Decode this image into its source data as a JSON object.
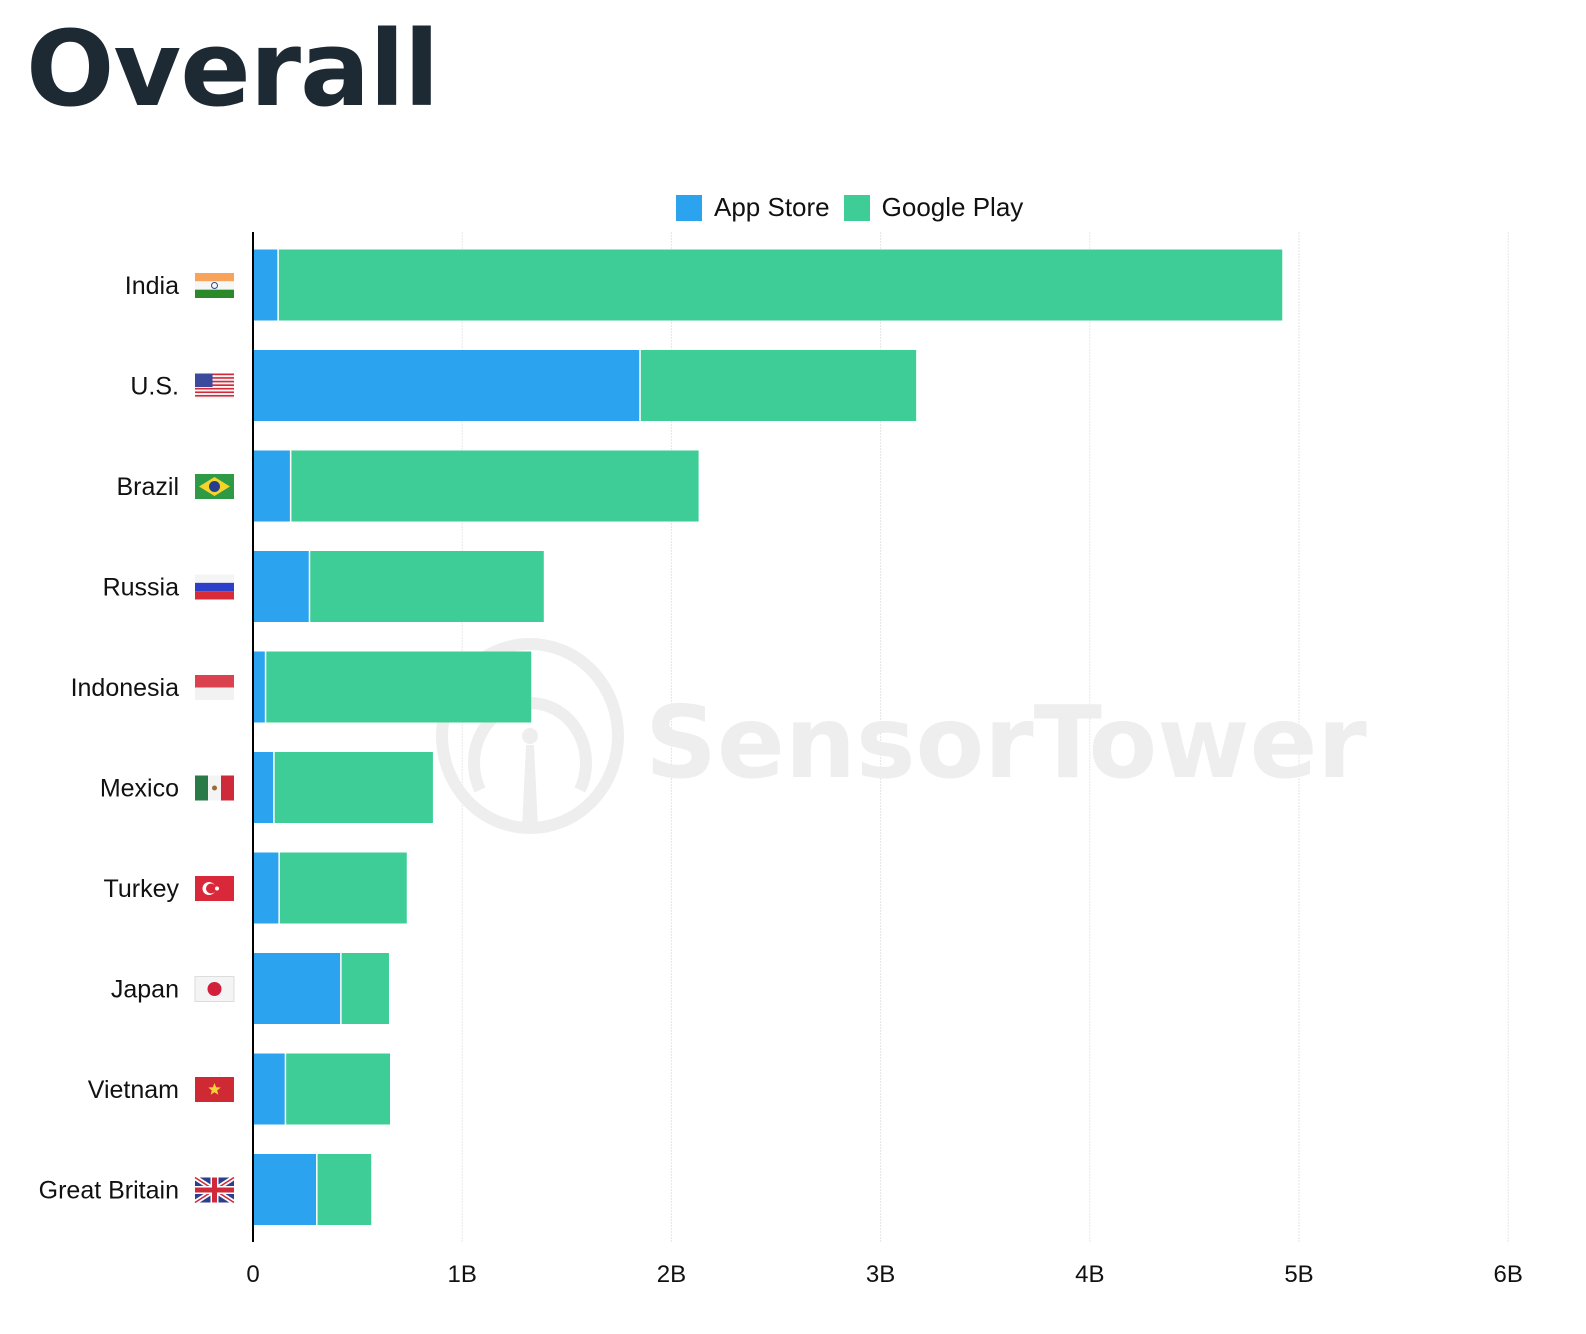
{
  "page": {
    "title": "Overall",
    "watermark": "SensorTower"
  },
  "colors": {
    "app_store": "#2ba3ee",
    "google_play": "#3ecd96",
    "title": "#1e2a33",
    "grid": "#e6e6e6",
    "axis": "#000000",
    "watermark": "#eeeeee"
  },
  "chart_data": {
    "type": "bar",
    "orientation": "horizontal",
    "stacked": true,
    "title": "Overall",
    "xlabel": "",
    "ylabel": "",
    "xlim": [
      0,
      6000000000
    ],
    "x_ticks": [
      "0",
      "1B",
      "2B",
      "3B",
      "4B",
      "5B",
      "6B"
    ],
    "x_tick_values": [
      0,
      1,
      2,
      3,
      4,
      5,
      6
    ],
    "unit": "billions",
    "grid": "vertical",
    "legend_position": "top-center",
    "categories": [
      "India",
      "U.S.",
      "Brazil",
      "Russia",
      "Indonesia",
      "Mexico",
      "Turkey",
      "Japan",
      "Vietnam",
      "Great Britain"
    ],
    "flags": [
      "flag-india",
      "flag-us",
      "flag-brazil",
      "flag-russia",
      "flag-indonesia",
      "flag-mexico",
      "flag-turkey",
      "flag-japan",
      "flag-vietnam",
      "flag-great-britain"
    ],
    "series": [
      {
        "name": "App Store",
        "color": "#2ba3ee",
        "values": [
          0.12,
          1.85,
          0.18,
          0.27,
          0.06,
          0.1,
          0.125,
          0.42,
          0.155,
          0.305
        ]
      },
      {
        "name": "Google Play",
        "color": "#3ecd96",
        "values": [
          4.8,
          1.32,
          1.95,
          1.12,
          1.27,
          0.76,
          0.61,
          0.23,
          0.5,
          0.26
        ]
      }
    ]
  }
}
